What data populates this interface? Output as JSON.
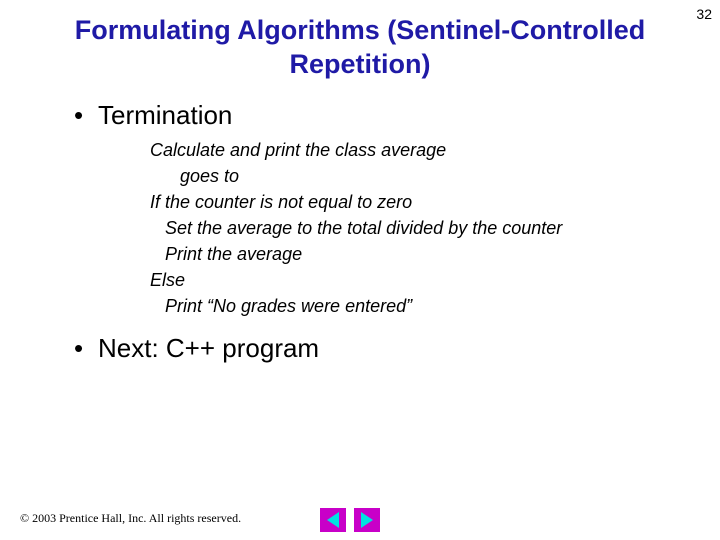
{
  "page_number": "32",
  "title": "Formulating Algorithms (Sentinel-Controlled Repetition)",
  "bullets": {
    "b1": "Termination",
    "b2": "Next: C++ program"
  },
  "pseudo": {
    "l0": "Calculate and print the class average",
    "l1": "      goes to",
    "l2": "If the counter is not equal to zero",
    "l3": "   Set the average to the total divided by the counter",
    "l4": "   Print the average",
    "l5": "Else",
    "l6": "   Print “No grades were entered”"
  },
  "footer": "© 2003 Prentice Hall, Inc.  All rights reserved.",
  "nav": {
    "prev_name": "prev-slide",
    "next_name": "next-slide"
  }
}
